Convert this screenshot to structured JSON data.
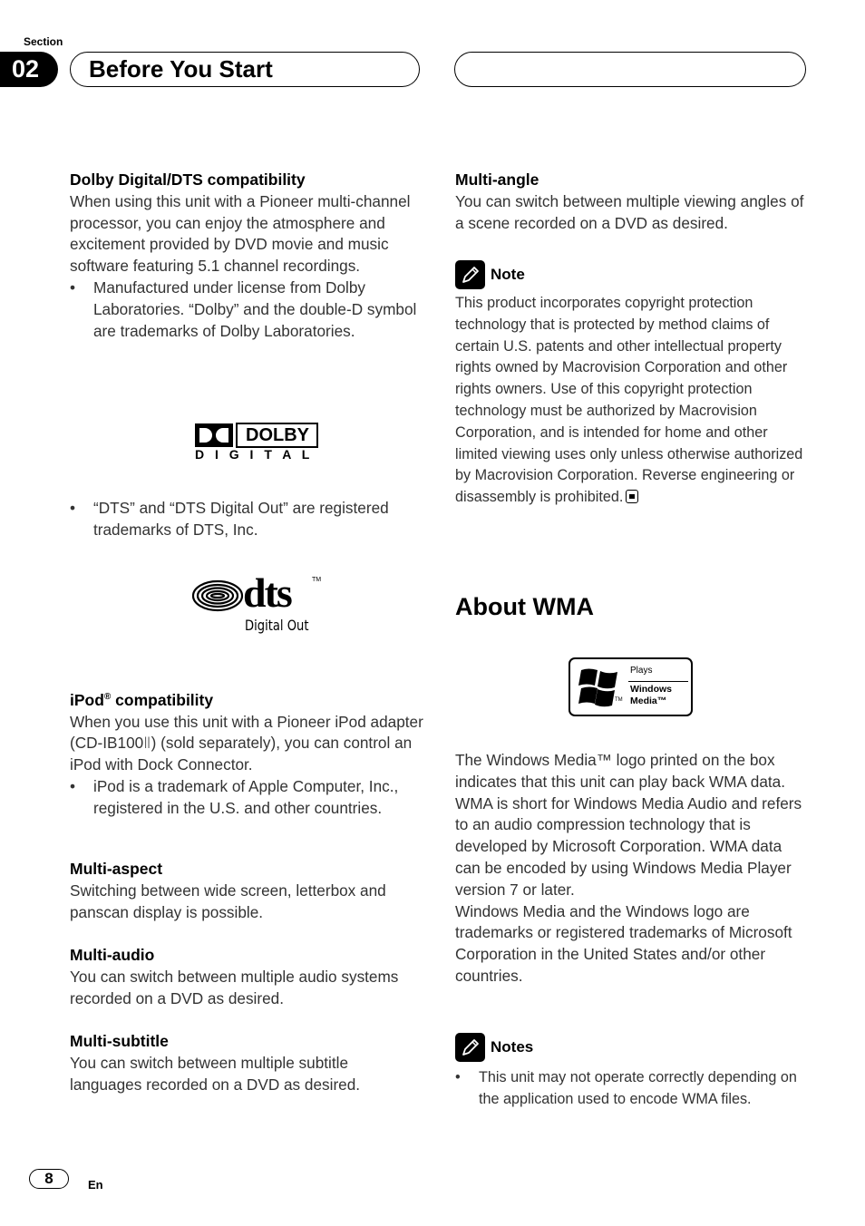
{
  "header": {
    "section_label": "Section",
    "section_number": "02",
    "title": "Before You Start"
  },
  "left": {
    "dolby": {
      "heading": "Dolby Digital/DTS compatibility",
      "body": "When using this unit with a Pioneer multi-channel processor, you can enjoy the atmosphere and excitement provided by DVD movie and music software featuring 5.1 channel recordings.",
      "bullet1": "Manufactured under license from Dolby Laboratories. “Dolby” and the double-D symbol are trademarks of Dolby Laboratories.",
      "logo_top": "DOLBY",
      "logo_bottom": "D I G I T A L",
      "bullet2": "“DTS” and  “DTS Digital Out” are registered trademarks of DTS, Inc."
    },
    "dts_logo": {
      "wordmark": "dts",
      "tm": "TM",
      "caption": "Digital Out"
    },
    "ipod": {
      "heading_main": "iPod",
      "heading_reg": "®",
      "heading_rest": " compatibility",
      "body": "When you use this unit with a Pioneer iPod adapter (CD-IB100Ⅱ) (sold separately), you can control an iPod with Dock Connector.",
      "bullet": "iPod is a trademark of Apple Computer, Inc., registered in the U.S. and other countries."
    },
    "multi_aspect": {
      "heading": "Multi-aspect",
      "body": "Switching between wide screen, letterbox and panscan display is possible."
    },
    "multi_audio": {
      "heading": "Multi-audio",
      "body": "You can switch between multiple audio systems recorded on a DVD as desired."
    },
    "multi_subtitle": {
      "heading": "Multi-subtitle",
      "body": "You can switch between multiple subtitle languages recorded on a DVD as desired."
    }
  },
  "right": {
    "multi_angle": {
      "heading": "Multi-angle",
      "body": "You can switch between multiple viewing angles of a scene recorded on a DVD as desired."
    },
    "note": {
      "title": "Note",
      "body": "This product incorporates copyright protection technology that is protected by method claims of certain U.S. patents and other intellectual property rights owned by Macrovision Corporation and other rights owners. Use of this copyright protection technology must be authorized by Macrovision Corporation, and is intended for home and other limited viewing uses only unless otherwise authorized by Macrovision Corporation. Reverse engineering or disassembly is prohibited."
    },
    "wma": {
      "heading": "About WMA",
      "logo_plays": "Plays",
      "logo_windows": "Windows",
      "logo_media": "Media™",
      "logo_tm": "TM",
      "para1": "The Windows Media™ logo printed on the box indicates that this unit can play back WMA data.",
      "para2": "WMA is short for Windows Media Audio and refers to an audio compression technology that is developed by Microsoft Corporation. WMA data can be encoded by using Windows Media Player version 7 or later.",
      "para3": "Windows Media and the Windows logo are trademarks or registered trademarks of Microsoft Corporation in the United States and/or other countries."
    },
    "notes": {
      "title": "Notes",
      "bullet": "This unit may not operate correctly depending on the application used to encode WMA files."
    }
  },
  "footer": {
    "page_number": "8",
    "language": "En"
  },
  "bullet_char": "•"
}
